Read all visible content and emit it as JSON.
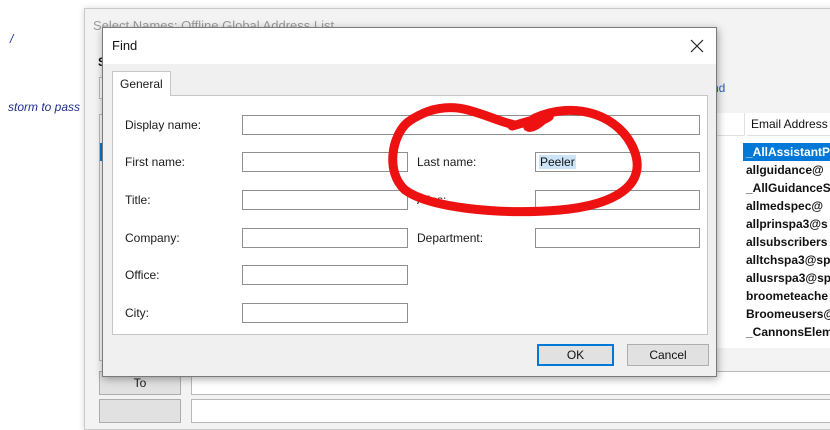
{
  "background": {
    "left_fragment_top": "/",
    "left_fragment_text": "storm to pass",
    "select_names_title": "Select Names: Offline Global Address List",
    "select_search_label_fragment": "S",
    "address_book_fragment": "nd",
    "columns": {
      "partial_col": "nt",
      "email": "Email Address"
    },
    "email_rows": [
      "_AllAssistantP",
      "allguidance@",
      "_AllGuidanceS",
      "allmedspec@",
      "allprinspa3@s",
      "allsubscribers",
      "alltchspa3@sp",
      "allusrspa3@sp",
      "broometeache",
      "Broomeusers@",
      "_CannonsElem"
    ],
    "to_button": "To"
  },
  "find_dialog": {
    "title": "Find",
    "tab_general": "General",
    "fields": {
      "display_name": {
        "label": "Display name:",
        "value": ""
      },
      "first_name": {
        "label": "First name:",
        "value": ""
      },
      "last_name": {
        "label": "Last name:",
        "value": "Peeler"
      },
      "title": {
        "label": "Title:",
        "value": ""
      },
      "alias": {
        "label": "Alias:",
        "value": ""
      },
      "company": {
        "label": "Company:",
        "value": ""
      },
      "department": {
        "label": "Department:",
        "value": ""
      },
      "office": {
        "label": "Office:",
        "value": ""
      },
      "city": {
        "label": "City:",
        "value": ""
      }
    },
    "ok_label": "OK",
    "cancel_label": "Cancel"
  },
  "colors": {
    "accent": "#0078d7",
    "annotation_red": "#ee1111",
    "text_selection": "#cce4f7"
  }
}
